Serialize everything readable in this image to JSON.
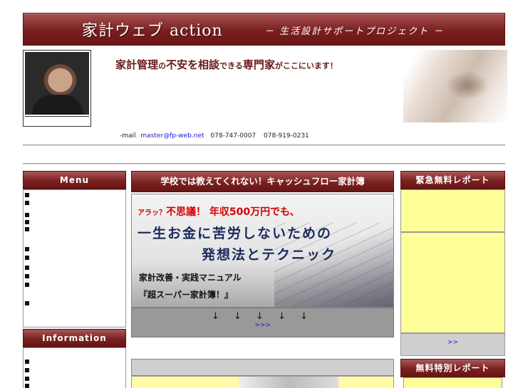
{
  "header": {
    "title": "家計ウェブ action",
    "subtitle": "－ 生活設計サポートプロジェクト －"
  },
  "tagline": {
    "part1": "家計管理",
    "part2": "の",
    "part3": "不安を相談",
    "part4": "できる",
    "part5": "専門家",
    "part6": "がここにいます！"
  },
  "contact": {
    "label": "-mail",
    "email": "master@fp-web.net",
    "tel1": "078-747-0007",
    "tel2": "078-919-0231"
  },
  "sidebar": {
    "menu_title": "Menu",
    "info_title": "Information"
  },
  "center": {
    "heading": "学校では教えてくれない！キャッシュフロー家計簿",
    "promo": {
      "line1_prefix": "アラッ？",
      "line1_main": "不思議！ 年収500万円でも、",
      "line2": "一生お金に苦労しないための",
      "line3": "発想法とテクニック",
      "line4": "家計改善・実践マニュアル",
      "line5": "『超スーパー家計簿！』"
    },
    "arrows": "↓ ↓ ↓ ↓ ↓",
    "more": ">>>"
  },
  "right": {
    "report1_title": "緊急無料レポート",
    "more": ">>",
    "report2_title": "無料特別レポート"
  }
}
